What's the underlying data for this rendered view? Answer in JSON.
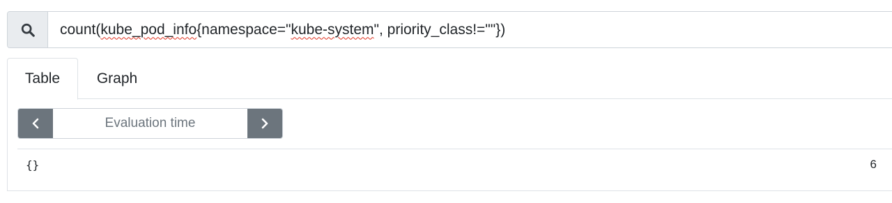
{
  "query": {
    "icon": "search-icon",
    "segments": [
      {
        "text": "count(",
        "flagged": false
      },
      {
        "text": "kube_pod_info",
        "flagged": true
      },
      {
        "text": "{namespace=\"",
        "flagged": false
      },
      {
        "text": "kube-system",
        "flagged": true
      },
      {
        "text": "\", priority_class!=\"\"})",
        "flagged": false
      }
    ]
  },
  "tabs": [
    {
      "label": "Table",
      "active": true
    },
    {
      "label": "Graph",
      "active": false
    }
  ],
  "time_control": {
    "prev_icon": "chevron-left-icon",
    "next_icon": "chevron-right-icon",
    "placeholder": "Evaluation time"
  },
  "result": {
    "metric": "{}",
    "value": "6"
  },
  "colors": {
    "nav_button": "#6c757d",
    "spellcheck": "#e0301e",
    "icon_box": "#e9ecef"
  }
}
